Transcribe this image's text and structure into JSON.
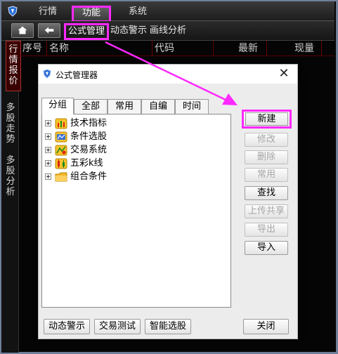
{
  "top_menu": {
    "items": [
      "行情",
      "功能",
      "系统"
    ]
  },
  "sub_menu": {
    "items": [
      "公式管理",
      "动态警示",
      "画线分析"
    ]
  },
  "side_tabs": [
    "行情报价",
    "多股走势",
    "多股分析"
  ],
  "columns": [
    "序号",
    "名称",
    "代码",
    "最新",
    "现量"
  ],
  "dialog": {
    "title": "公式管理器",
    "tabs": [
      "分组",
      "全部",
      "常用",
      "自编",
      "时间"
    ],
    "tree_items": [
      {
        "label": "技术指标",
        "icon": "indicator-icon"
      },
      {
        "label": "条件选股",
        "icon": "screener-icon"
      },
      {
        "label": "交易系统",
        "icon": "trade-system-icon"
      },
      {
        "label": "五彩k线",
        "icon": "color-kline-icon"
      },
      {
        "label": "组合条件",
        "icon": "folder-icon"
      }
    ],
    "right_buttons": {
      "new": "新建",
      "modify": "修改",
      "delete": "删除",
      "common": "常用",
      "find": "查找",
      "upload": "上传共享",
      "export": "导出",
      "import": "导入"
    },
    "bottom_buttons": {
      "alert": "动态警示",
      "test": "交易测试",
      "smart": "智能选股",
      "close": "关闭"
    }
  },
  "colors": {
    "highlight": "#ff29ff",
    "disabled_text": "#a5a5a5"
  }
}
